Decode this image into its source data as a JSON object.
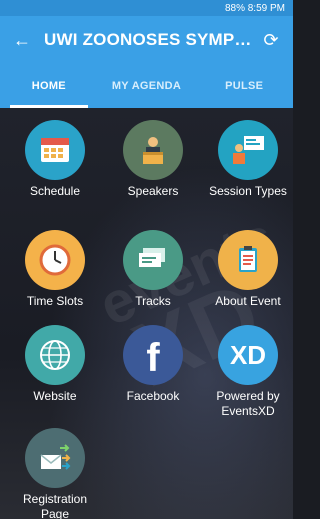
{
  "status": {
    "text": "88%  8:59 PM"
  },
  "app_bar": {
    "title": "UWI ZOONOSES SYMPOS..."
  },
  "tabs": [
    {
      "label": "HOME",
      "active": true
    },
    {
      "label": "MY AGENDA",
      "active": false
    },
    {
      "label": "PULSE",
      "active": false
    }
  ],
  "background": {
    "watermark": "events XD"
  },
  "tiles": [
    {
      "label": "Schedule",
      "icon": "calendar-icon",
      "color": "#2aa3c9"
    },
    {
      "label": "Speakers",
      "icon": "speaker-podium-icon",
      "color": "#5c7a60"
    },
    {
      "label": "Session Types",
      "icon": "presentation-icon",
      "color": "#23a3c2"
    },
    {
      "label": "Time Slots",
      "icon": "clock-icon",
      "color": "#f4b24a"
    },
    {
      "label": "Tracks",
      "icon": "cards-icon",
      "color": "#4a9a86"
    },
    {
      "label": "About Event",
      "icon": "clipboard-icon",
      "color": "#f0b24a"
    },
    {
      "label": "Website",
      "icon": "globe-icon",
      "color": "#41a9a8"
    },
    {
      "label": "Facebook",
      "icon": "facebook-icon",
      "color": "#3b5998"
    },
    {
      "label": "Powered by EventsXD",
      "icon": "eventsxd-logo-icon",
      "color": "#38a3e0"
    },
    {
      "label": "Registration Page",
      "icon": "registration-icon",
      "color": "#4d6d72"
    }
  ]
}
